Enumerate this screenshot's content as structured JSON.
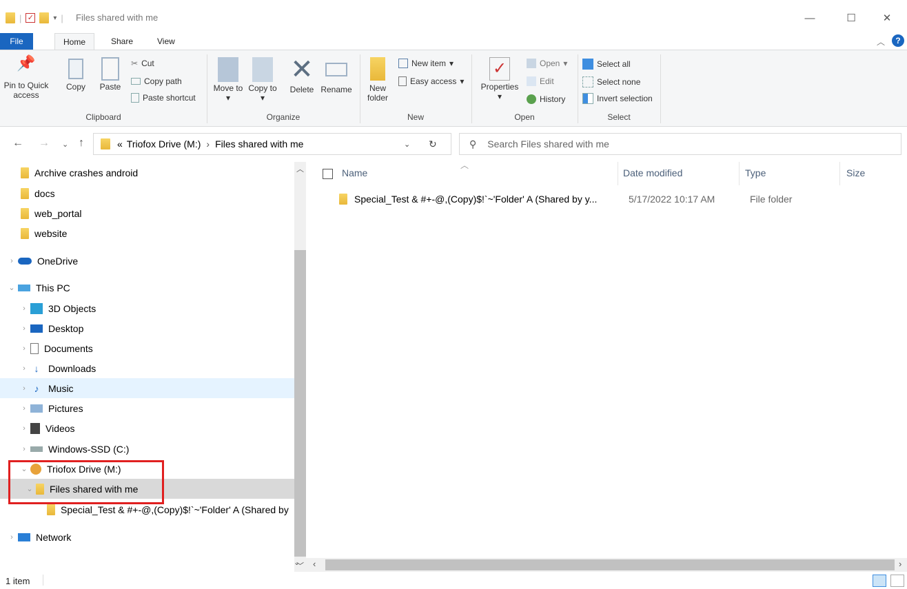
{
  "window": {
    "title": "Files shared with me",
    "minimize": "—",
    "maximize": "☐",
    "close": "✕"
  },
  "ribbon_tabs": [
    "File",
    "Home",
    "Share",
    "View"
  ],
  "ribbon": {
    "clipboard": {
      "pin": "Pin to Quick access",
      "copy": "Copy",
      "paste": "Paste",
      "cut": "Cut",
      "copy_path": "Copy path",
      "paste_shortcut": "Paste shortcut",
      "label": "Clipboard"
    },
    "organize": {
      "move_to": "Move to",
      "copy_to": "Copy to",
      "delete": "Delete",
      "rename": "Rename",
      "label": "Organize"
    },
    "new": {
      "new_folder": "New folder",
      "new_item": "New item",
      "easy_access": "Easy access",
      "label": "New"
    },
    "open": {
      "properties": "Properties",
      "open": "Open",
      "edit": "Edit",
      "history": "History",
      "label": "Open"
    },
    "select": {
      "select_all": "Select all",
      "select_none": "Select none",
      "invert": "Invert selection",
      "label": "Select"
    }
  },
  "address": {
    "root": "«",
    "segment1": "Triofox Drive (M:)",
    "segment2": "Files shared with me",
    "search_placeholder": "Search Files shared with me"
  },
  "nav": [
    {
      "label": "Archive crashes android"
    },
    {
      "label": "docs"
    },
    {
      "label": "web_portal"
    },
    {
      "label": "website"
    },
    {
      "label": "OneDrive"
    },
    {
      "label": "This PC"
    },
    {
      "label": "3D Objects"
    },
    {
      "label": "Desktop"
    },
    {
      "label": "Documents"
    },
    {
      "label": "Downloads"
    },
    {
      "label": "Music"
    },
    {
      "label": "Pictures"
    },
    {
      "label": "Videos"
    },
    {
      "label": "Windows-SSD (C:)"
    },
    {
      "label": "Triofox Drive (M:)"
    },
    {
      "label": "Files shared with me"
    },
    {
      "label": "Special_Test & #+-@,(Copy)$!`~'Folder' A (Shared by"
    },
    {
      "label": "Network"
    }
  ],
  "columns": {
    "name": "Name",
    "date": "Date modified",
    "type": "Type",
    "size": "Size"
  },
  "files": [
    {
      "name": "Special_Test & #+-@,(Copy)$!`~'Folder' A (Shared by y...",
      "date": "5/17/2022 10:17 AM",
      "type": "File folder"
    }
  ],
  "status": {
    "count": "1 item"
  },
  "colors": {
    "file_tab": "#1a66c0",
    "selection": "#d9d9d9",
    "hover": "#e5f3ff",
    "highlight_box": "#e02020"
  }
}
